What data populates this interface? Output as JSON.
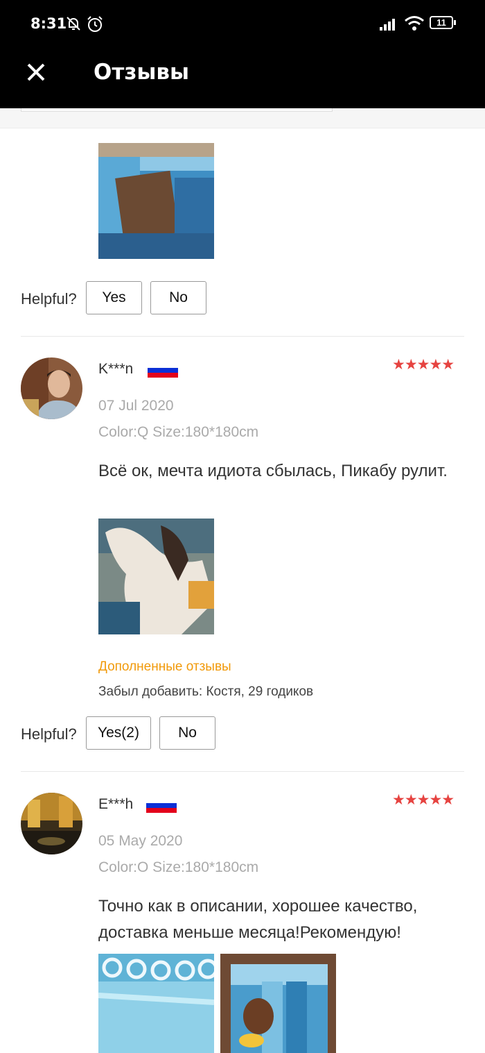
{
  "status": {
    "time": "8:31",
    "battery": "11"
  },
  "header": {
    "title": "Отзывы"
  },
  "previous": {
    "helpful_label": "Helpful?",
    "yes_label": "Yes",
    "no_label": "No"
  },
  "reviews": [
    {
      "name": "K***n",
      "date": "07 Jul 2020",
      "variant": "Color:Q Size:180*180cm",
      "stars": "★★★★★",
      "text": "Всё ок, мечта идиота сбылась, Пикабу рулит.",
      "additional_title": "Дополненные отзывы",
      "additional_text": "Забыл добавить: Костя, 29 годиков",
      "helpful_label": "Helpful?",
      "yes_label": "Yes(2)",
      "no_label": "No"
    },
    {
      "name": "E***h",
      "date": "05 May 2020",
      "variant": "Color:O Size:180*180cm",
      "stars": "★★★★★",
      "text": "Точно как в описании, хорошее качество, доставка меньше месяца!Рекомендую!"
    }
  ],
  "colors": {
    "accent_star": "#e64340",
    "additional_title": "#f19a0b",
    "bar": "#000000"
  },
  "icons": {
    "close": "close-icon",
    "mute": "bell-off-icon",
    "alarm": "alarm-icon",
    "signal": "signal-icon",
    "wifi": "wifi-icon",
    "battery": "battery-icon",
    "flag": "russia-flag-icon"
  }
}
